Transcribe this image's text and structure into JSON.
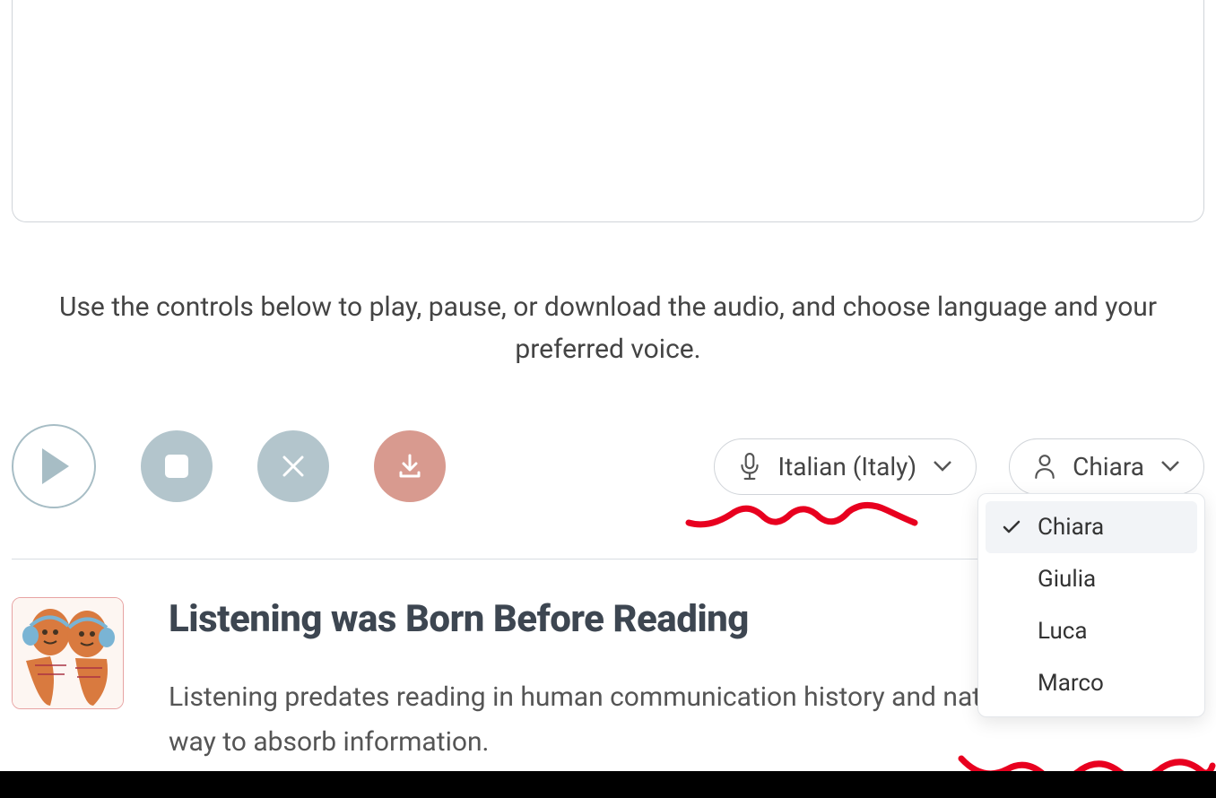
{
  "instructions": "Use the controls below to play, pause, or download the audio, and choose language and your preferred voice.",
  "language_dropdown": {
    "label": "Italian (Italy)"
  },
  "voice_dropdown": {
    "label": "Chiara",
    "options": [
      "Chiara",
      "Giulia",
      "Luca",
      "Marco"
    ],
    "selected": "Chiara"
  },
  "article": {
    "title": "Listening was Born Before Reading",
    "body": "Listening predates reading in human communication history and natural and intuitive way to absorb information."
  }
}
